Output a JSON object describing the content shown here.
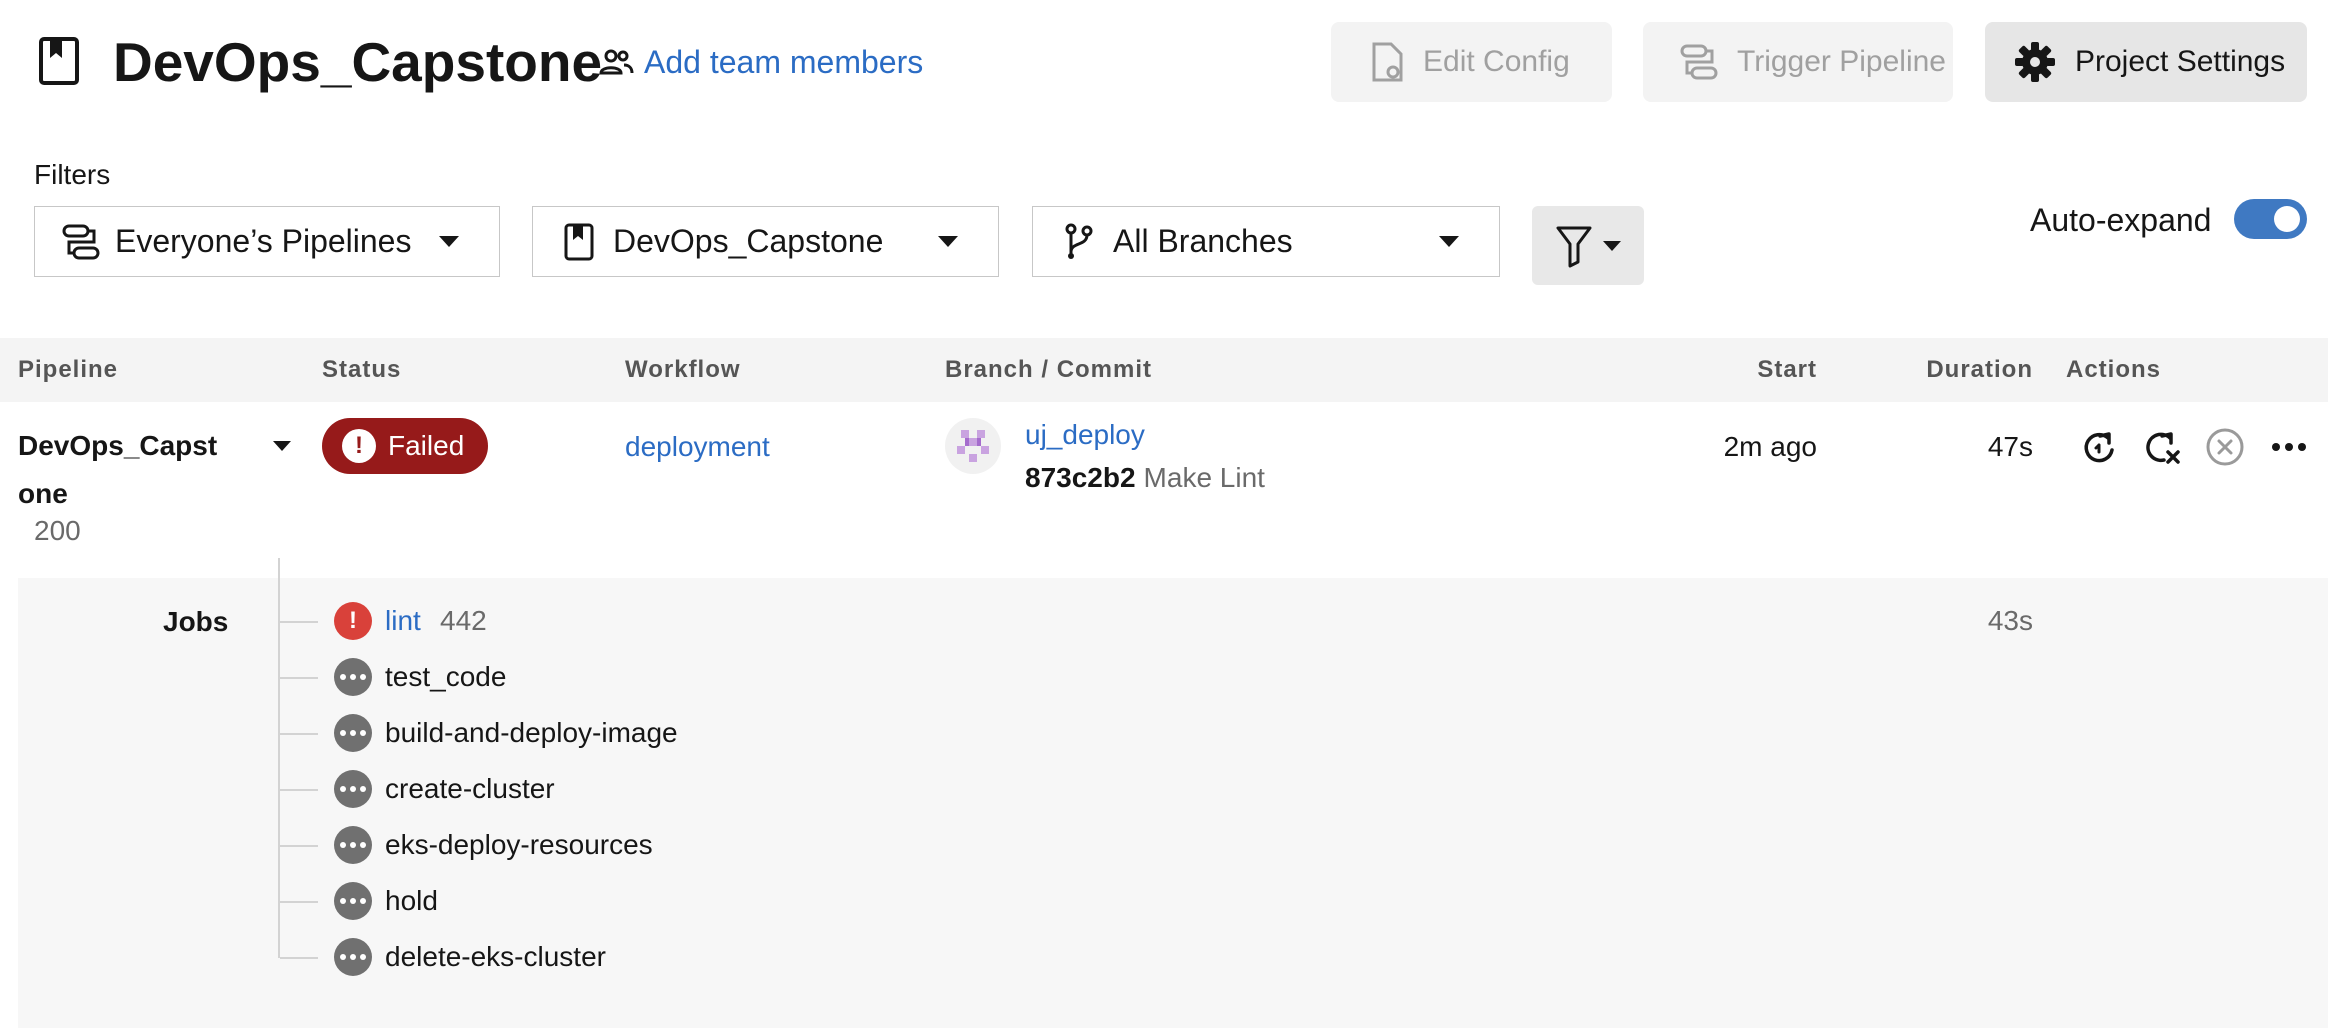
{
  "header": {
    "project_name": "DevOps_Capstone",
    "add_team_label": "Add team members",
    "edit_config_label": "Edit Config",
    "trigger_pipeline_label": "Trigger Pipeline",
    "project_settings_label": "Project Settings"
  },
  "filters": {
    "label": "Filters",
    "pipelines_value": "Everyone’s Pipelines",
    "project_value": "DevOps_Capstone",
    "branch_value": "All Branches",
    "auto_expand_label": "Auto-expand",
    "auto_expand_on": true
  },
  "table": {
    "columns": {
      "pipeline": "Pipeline",
      "status": "Status",
      "workflow": "Workflow",
      "branch_commit": "Branch / Commit",
      "start": "Start",
      "duration": "Duration",
      "actions": "Actions"
    },
    "row": {
      "pipeline_name": "DevOps_Capstone",
      "pipeline_number": "200",
      "status": "Failed",
      "workflow": "deployment",
      "branch": "uj_deploy",
      "commit_hash": "873c2b2",
      "commit_message": "Make Lint",
      "start": "2m ago",
      "duration": "47s"
    }
  },
  "jobs": {
    "label": "Jobs",
    "items": [
      {
        "name": "lint",
        "number": "442",
        "duration": "43s",
        "status": "failed"
      },
      {
        "name": "test_code",
        "status": "pending"
      },
      {
        "name": "build-and-deploy-image",
        "status": "pending"
      },
      {
        "name": "create-cluster",
        "status": "pending"
      },
      {
        "name": "eks-deploy-resources",
        "status": "pending"
      },
      {
        "name": "hold",
        "status": "pending"
      },
      {
        "name": "delete-eks-cluster",
        "status": "pending"
      }
    ]
  },
  "colors": {
    "link": "#2b6cc4",
    "failed_badge": "#961a1a",
    "failed_job": "#d9413a",
    "pending_job": "#707070",
    "toggle_on": "#3f79c2"
  }
}
